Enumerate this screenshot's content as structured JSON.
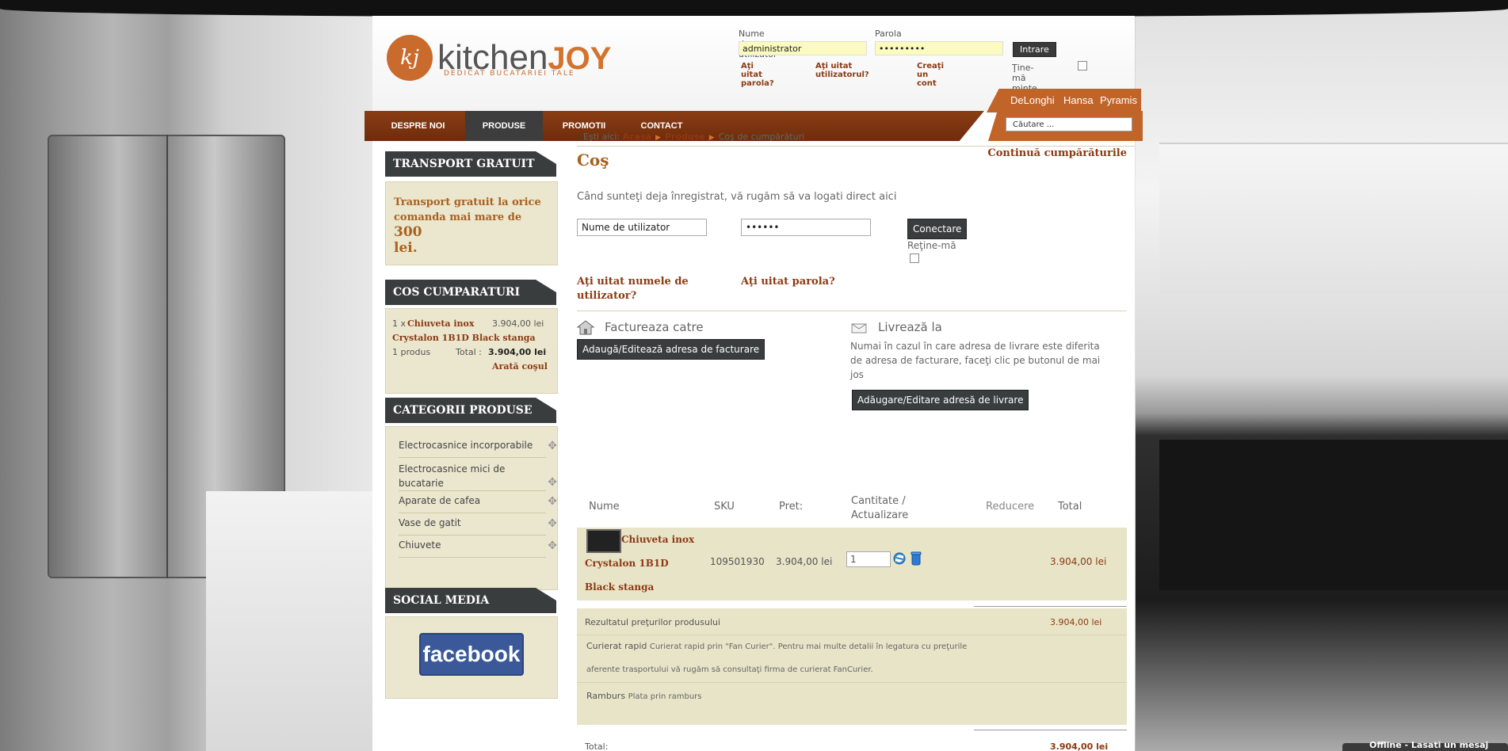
{
  "header": {
    "login": {
      "user_label": "Nume de utilizator",
      "user_value": "administrator",
      "pass_label": "Parola",
      "pass_value": "•••••••••",
      "button": "Intrare",
      "forgot_pass": "Aţi uitat parola?",
      "forgot_user": "Aţi uitat utilizatorul?",
      "create": "Creaţi un cont",
      "remember": "Ţine-mă minte"
    },
    "brands": [
      "DeLonghi",
      "Hansa",
      "Pyramis"
    ],
    "nav": [
      "DESPRE NOI",
      "PRODUSE",
      "PROMOTII",
      "CONTACT"
    ],
    "search_placeholder": "Căutare ..."
  },
  "sidebar": {
    "transport": {
      "title": "TRANSPORT GRATUIT",
      "text1": "Transport gratuit la orice",
      "text2": "comanda mai mare de",
      "amount": "300",
      "unit": "lei."
    },
    "cart": {
      "title": "COS CUMPARATURI",
      "item_qty": "1 x",
      "item_name_1": "Chiuveta inox",
      "item_price": "3.904,00 lei",
      "item_name_2": "Crystalon 1B1D Black stanga",
      "count": "1 produs",
      "total_label": "Total :",
      "total": "3.904,00 lei",
      "show_cart": "Arată coşul"
    },
    "categories": {
      "title": "CATEGORII PRODUSE",
      "items": [
        "Electrocasnice incorporabile",
        "Electrocasnice mici de bucatarie",
        "Aparate de cafea",
        "Vase de gatit",
        "Chiuvete"
      ]
    },
    "social": {
      "title": "SOCIAL MEDIA",
      "facebook": "facebook"
    }
  },
  "main": {
    "breadcrumb": {
      "prefix": "Eşti aici:",
      "home": "Acasă",
      "products": "Produse",
      "current": "Coş de cumpărături"
    },
    "title": "Coş",
    "continue": "Continuă cumpărăturile",
    "login_hint": "Când sunteţi deja înregistrat, vă rugăm să va logati direct aici",
    "user_placeholder": "Nume de utilizator",
    "pass_value": "••••••",
    "connect": "Conectare",
    "remember": "Reţine-mă",
    "forgot_user": "Aţi uitat numele de utilizator?",
    "forgot_pass": "Aţi uitat parola?",
    "bill_to": "Factureaza catre",
    "bill_button": "Adaugă/Editează adresa de facturare",
    "ship_to": "Livrează la",
    "ship_hint": "Numai în cazul în care adresa de livrare este diferita de adresa de facturare, faceţi clic pe butonul de mai jos",
    "ship_button": "Adăugare/Editare adresă de livrare",
    "table": {
      "headers": [
        "Nume",
        "SKU",
        "Pret:",
        "Cantitate / Actualizare",
        "Reducere",
        "Total"
      ],
      "row": {
        "name": "Chiuveta inox Crystalon 1B1D Black stanga",
        "sku": "109501930",
        "price": "3.904,00 lei",
        "qty": "1",
        "total": "3.904,00 lei"
      },
      "subtotal_label": "Rezultatul preţurilor produsului",
      "subtotal": "3.904,00 lei",
      "courier_title": "Curierat rapid",
      "courier_text_1": "Curierat rapid prin \"Fan Curier\". Pentru mai multe detalii în legatura cu preţurile",
      "courier_text_2": "aferente trasportului vă rugăm să consultaţi firma de curierat FanCurier.",
      "cod_title": "Ramburs",
      "cod_text": "Plata prin ramburs",
      "total_label": "Total:",
      "total": "3.904,00 lei"
    }
  },
  "chat": "Offline - Lasati un mesaj"
}
